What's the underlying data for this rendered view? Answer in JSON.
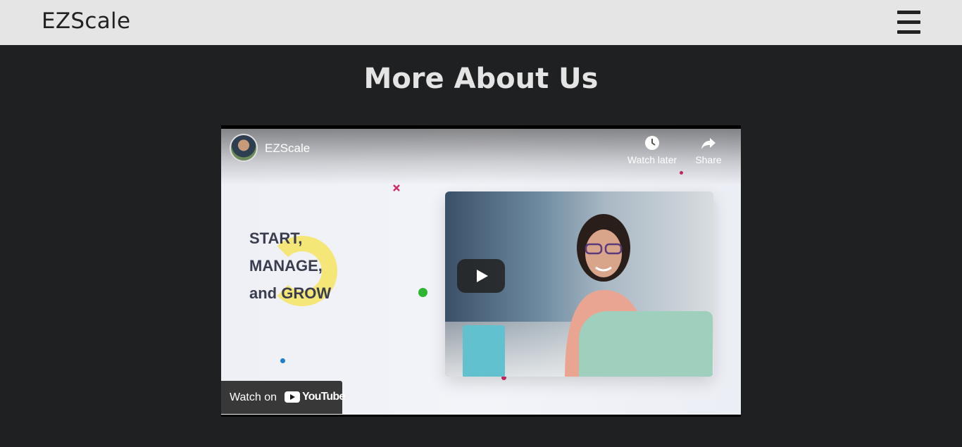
{
  "navbar": {
    "brand": "EZScale",
    "menu_icon": "hamburger-menu-icon"
  },
  "main": {
    "title": "More About Us"
  },
  "video": {
    "channel_name": "EZScale",
    "watch_later_label": "Watch later",
    "share_label": "Share",
    "watch_on_label": "Watch on",
    "youtube_label": "YouTube",
    "thumbnail_text": [
      "START,",
      "MANAGE,",
      "and GROW"
    ]
  }
}
